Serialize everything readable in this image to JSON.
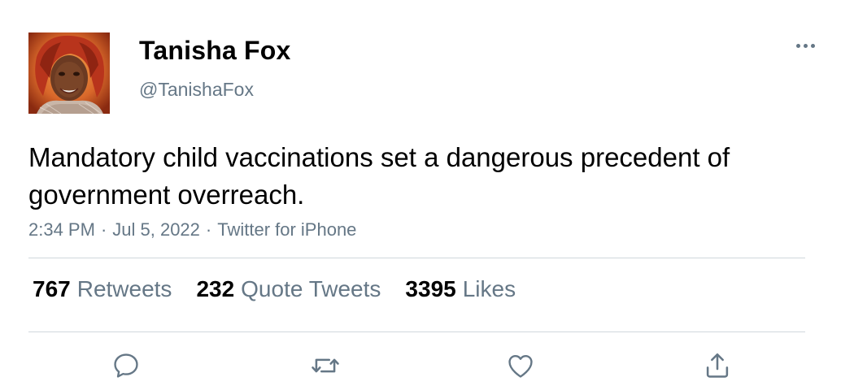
{
  "author": {
    "display_name": "Tanisha Fox",
    "handle": "@TanishaFox"
  },
  "menu": {
    "icon": "more-horizontal-icon"
  },
  "tweet": {
    "text": "Mandatory child vaccinations set a dangerous precedent of government overreach.",
    "time": "2:34 PM",
    "date": "Jul 5, 2022",
    "source": "Twitter for iPhone",
    "separator": "·"
  },
  "stats": {
    "retweets": {
      "count": "767",
      "label": "Retweets"
    },
    "quote_tweets": {
      "count": "232",
      "label": "Quote Tweets"
    },
    "likes": {
      "count": "3395",
      "label": "Likes"
    }
  },
  "actions": [
    {
      "name": "reply",
      "icon": "speech-bubble-icon"
    },
    {
      "name": "retweet",
      "icon": "retweet-arrows-icon"
    },
    {
      "name": "like",
      "icon": "heart-icon"
    },
    {
      "name": "share",
      "icon": "share-upload-icon"
    }
  ],
  "colors": {
    "text_primary": "#000000",
    "text_secondary": "#657786",
    "divider": "#d0d7dc",
    "icon": "#657786"
  }
}
